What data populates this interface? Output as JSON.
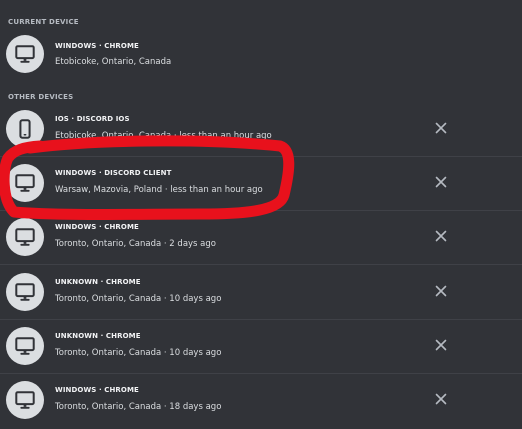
{
  "sections": {
    "current_label": "CURRENT DEVICE",
    "other_label": "OTHER DEVICES"
  },
  "current_device": {
    "platform": "WINDOWS · CHROME",
    "location": "Etobicoke, Ontario, Canada",
    "icon": "desktop-icon"
  },
  "other_devices": [
    {
      "platform": "IOS · DISCORD IOS",
      "details": "Etobicoke, Ontario, Canada · less than an hour ago",
      "icon": "mobile-phone-icon"
    },
    {
      "platform": "WINDOWS · DISCORD CLIENT",
      "details": "Warsaw, Mazovia, Poland · less than an hour ago",
      "icon": "desktop-icon"
    },
    {
      "platform": "WINDOWS · CHROME",
      "details": "Toronto, Ontario, Canada · 2 days ago",
      "icon": "desktop-icon"
    },
    {
      "platform": "UNKNOWN · CHROME",
      "details": "Toronto, Ontario, Canada · 10 days ago",
      "icon": "desktop-icon"
    },
    {
      "platform": "UNKNOWN · CHROME",
      "details": "Toronto, Ontario, Canada · 10 days ago",
      "icon": "desktop-icon"
    },
    {
      "platform": "WINDOWS · CHROME",
      "details": "Toronto, Ontario, Canada · 18 days ago",
      "icon": "desktop-icon"
    }
  ],
  "colors": {
    "background": "#313338",
    "icon_bg": "#dbdee1",
    "icon_fg": "#313338",
    "annotation": "#e8111c"
  }
}
